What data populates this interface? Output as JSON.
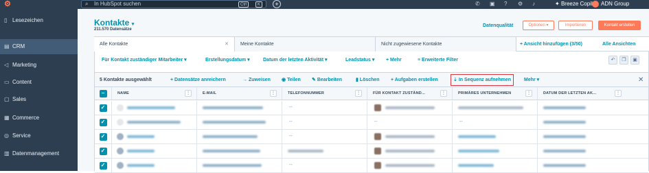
{
  "topbar": {
    "search_placeholder": "In HubSpot suchen",
    "kbd_ctrl": "Ctrl",
    "kbd_k": "K",
    "copilot": "Breeze Copilot",
    "account": "ADN Group"
  },
  "sidebar": {
    "items": [
      {
        "label": "Lesezeichen",
        "icon": "bookmark-icon"
      },
      {
        "label": "CRM",
        "icon": "contacts-icon"
      },
      {
        "label": "Marketing",
        "icon": "megaphone-icon"
      },
      {
        "label": "Content",
        "icon": "document-icon"
      },
      {
        "label": "Sales",
        "icon": "briefcase-icon"
      },
      {
        "label": "Commerce",
        "icon": "cart-icon"
      },
      {
        "label": "Service",
        "icon": "headset-icon"
      },
      {
        "label": "Datenmanagement",
        "icon": "database-icon"
      }
    ]
  },
  "header": {
    "title": "Kontakte",
    "subtitle": "211.570 Datensätze",
    "data_quality": "Datenqualität",
    "options": "Optionen",
    "import": "Importieren",
    "create": "Kontakt erstellen"
  },
  "tabs": {
    "items": [
      "Alle Kontakte",
      "Meine Kontakte",
      "Nicht zugewiesene Kontakte"
    ],
    "add_view": "Ansicht hinzufügen (3/50)",
    "all_views": "Alle Ansichten"
  },
  "filters": {
    "owner": "Für Kontakt zuständiger Mitarbeiter",
    "created": "Erstellungsdatum",
    "last_activity": "Datum der letzten Aktivität",
    "lead_status": "Leadstatus",
    "more": "Mehr",
    "advanced": "Erweiterte Filter"
  },
  "bulk": {
    "selected": "5 Kontakte ausgewählt",
    "enrich": "Datensätze anreichern",
    "assign": "Zuweisen",
    "share": "Teilen",
    "edit": "Bearbeiten",
    "delete": "Löschen",
    "create_tasks": "Aufgaben erstellen",
    "enroll_sequence": "In Sequenz aufnehmen",
    "more": "Mehr"
  },
  "table": {
    "columns": [
      "NAME",
      "E-MAIL",
      "TELEFONNUMMER",
      "FÜR KONTAKT ZUSTÄND...",
      "PRIMÄRES UNTERNEHMEN",
      "DATUM DER LETZTEN AK..."
    ],
    "dash": "--"
  },
  "colors": {
    "accent": "#0091ae",
    "brand": "#ff7a59",
    "highlight": "#d9363e",
    "nav": "#2d3e50"
  }
}
